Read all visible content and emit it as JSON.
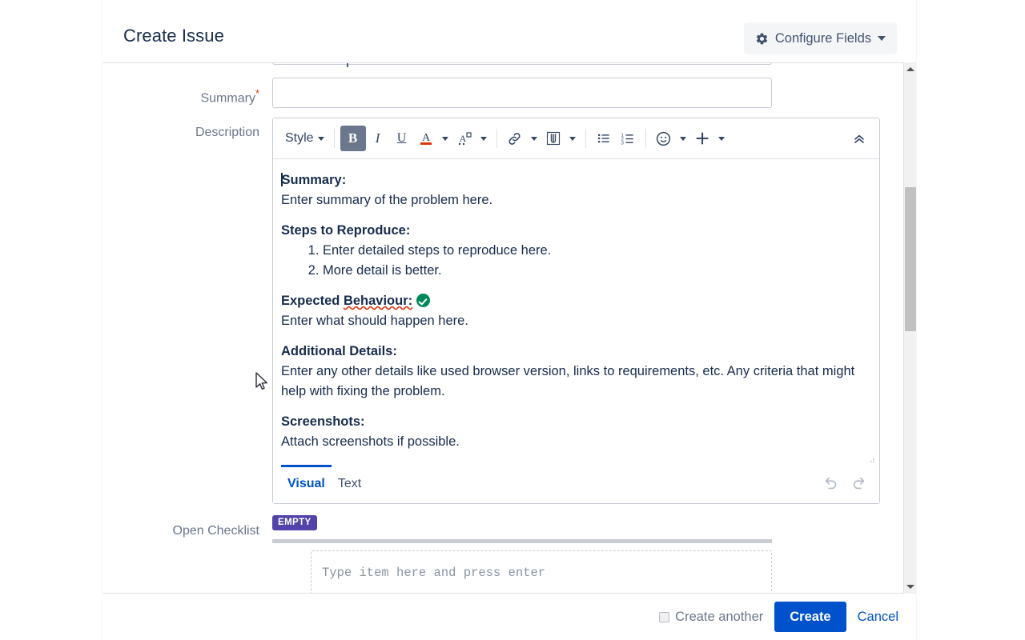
{
  "header": {
    "title": "Create Issue",
    "configure_fields_label": "Configure Fields",
    "gear_icon": "gear-icon",
    "caret_icon": "chevron-down-icon"
  },
  "fields": {
    "summary": {
      "label": "Summary",
      "required_marker": "*",
      "value": "",
      "placeholder": ""
    },
    "description": {
      "label": "Description"
    },
    "checklist": {
      "label": "Open Checklist",
      "badge": "EMPTY",
      "input_value": "",
      "input_placeholder": "Type item here and press enter"
    }
  },
  "toolbar": {
    "style_label": "Style",
    "bold_label": "B",
    "italic_label": "I",
    "underline_label": "U",
    "text_color_label": "A",
    "highlight_color_label": "A",
    "items": [
      {
        "name": "style-dropdown",
        "label": "Style",
        "has_caret": true,
        "active": false
      },
      {
        "name": "bold-button",
        "label": "B",
        "has_caret": false,
        "active": true
      },
      {
        "name": "italic-button",
        "label": "I",
        "has_caret": false,
        "active": false
      },
      {
        "name": "underline-button",
        "label": "U",
        "has_caret": false,
        "active": false
      },
      {
        "name": "text-color-button",
        "label": "A",
        "has_caret": true,
        "active": false
      },
      {
        "name": "highlight-color-button",
        "label": "A",
        "has_caret": true,
        "active": false
      },
      {
        "name": "link-button",
        "label": "",
        "has_caret": true,
        "active": false
      },
      {
        "name": "attachment-button",
        "label": "",
        "has_caret": true,
        "active": false
      },
      {
        "name": "bullet-list-button",
        "label": "",
        "has_caret": false,
        "active": false
      },
      {
        "name": "numbered-list-button",
        "label": "",
        "has_caret": false,
        "active": false
      },
      {
        "name": "emoji-button",
        "label": "",
        "has_caret": true,
        "active": false
      },
      {
        "name": "insert-more-button",
        "label": "+",
        "has_caret": true,
        "active": false
      },
      {
        "name": "collapse-toolbar-button",
        "label": "",
        "has_caret": false,
        "active": false
      }
    ]
  },
  "description_content": {
    "summary_heading": "Summary:",
    "summary_text": "Enter summary of the problem here.",
    "steps_heading": "Steps to Reproduce:",
    "steps": [
      "Enter detailed steps to reproduce here.",
      "More detail is better."
    ],
    "expected_heading_part1": "Expected ",
    "expected_heading_misspelled": "Behaviour:",
    "expected_text": "Enter what should happen here.",
    "additional_heading": "Additional Details:",
    "additional_text": "Enter any other details like used browser version, links to requirements, etc. Any criteria that might help with fixing the problem.",
    "screenshots_heading": "Screenshots:",
    "screenshots_text": "Attach screenshots if possible."
  },
  "editor_footer": {
    "tabs": [
      {
        "label": "Visual",
        "active": true
      },
      {
        "label": "Text",
        "active": false
      }
    ],
    "undo_icon": "undo-icon",
    "redo_icon": "redo-icon"
  },
  "footer": {
    "create_another_label": "Create another",
    "create_another_checked": false,
    "create_label": "Create",
    "cancel_label": "Cancel"
  },
  "colors": {
    "primary_blue": "#0052cc",
    "badge_purple": "#5243aa",
    "required_red": "#de350b",
    "success_green": "#00875a",
    "label_gray": "#6b778c",
    "bold_active_bg": "#6b778c"
  },
  "scrollbar": {
    "up_arrow": "scroll-up-arrow",
    "down_arrow": "scroll-down-arrow",
    "thumb": "scroll-thumb"
  }
}
